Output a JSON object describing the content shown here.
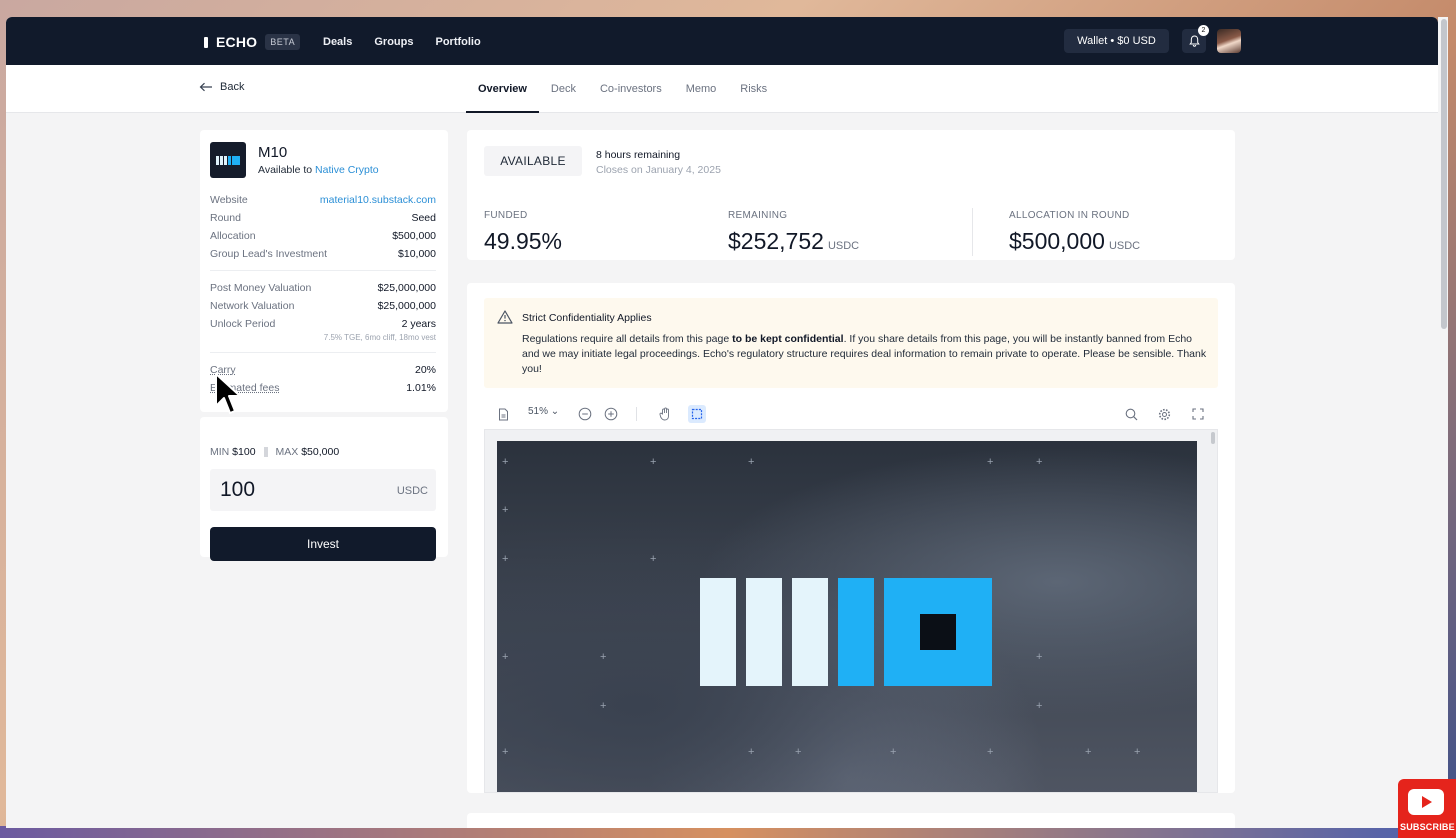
{
  "nav": {
    "logo": "ECHO",
    "badge": "BETA",
    "links": [
      "Deals",
      "Groups",
      "Portfolio"
    ],
    "wallet": "Wallet • $0 USD",
    "notification_count": "2"
  },
  "subnav": {
    "back": "Back",
    "tabs": [
      "Overview",
      "Deck",
      "Co-investors",
      "Memo",
      "Risks"
    ],
    "active_tab": "Overview"
  },
  "deal": {
    "name": "M10",
    "available_prefix": "Available to",
    "available_group": "Native Crypto",
    "details": [
      {
        "label": "Website",
        "value": "material10.substack.com"
      },
      {
        "label": "Round",
        "value": "Seed"
      },
      {
        "label": "Allocation",
        "value": "$500,000"
      },
      {
        "label": "Group Lead's Investment",
        "value": "$10,000"
      }
    ],
    "valuation": [
      {
        "label": "Post Money Valuation",
        "value": "$25,000,000"
      },
      {
        "label": "Network Valuation",
        "value": "$25,000,000"
      },
      {
        "label": "Unlock Period",
        "value": "2 years"
      }
    ],
    "unlock_note": "7.5% TGE, 6mo cliff, 18mo vest",
    "fees": [
      {
        "label": "Carry",
        "value": "20%"
      },
      {
        "label": "Estimated fees",
        "value": "1.01%"
      }
    ]
  },
  "invest": {
    "min_label": "MIN",
    "min_value": "$100",
    "max_label": "MAX",
    "max_value": "$50,000",
    "amount": "100",
    "currency": "USDC",
    "button": "Invest"
  },
  "status": {
    "badge": "AVAILABLE",
    "time_remaining": "8 hours remaining",
    "closes": "Closes on January 4, 2025",
    "funded_label": "FUNDED",
    "funded_value": "49.95%",
    "remaining_label": "REMAINING",
    "remaining_value": "$252,752",
    "allocation_label": "ALLOCATION IN ROUND",
    "allocation_value": "$500,000",
    "currency": "USDC"
  },
  "warning": {
    "title": "Strict Confidentiality Applies",
    "body_pre": "Regulations require all details from this page ",
    "body_bold": "to be kept confidential",
    "body_post": ". If you share details from this page, you will be instantly banned from Echo and we may initiate legal proceedings. Echo's regulatory structure requires deal information to remain private to operate. Please be sensible. Thank you!"
  },
  "viewer": {
    "zoom": "51%"
  },
  "overlay": {
    "youtube": "SUBSCRIBE"
  }
}
